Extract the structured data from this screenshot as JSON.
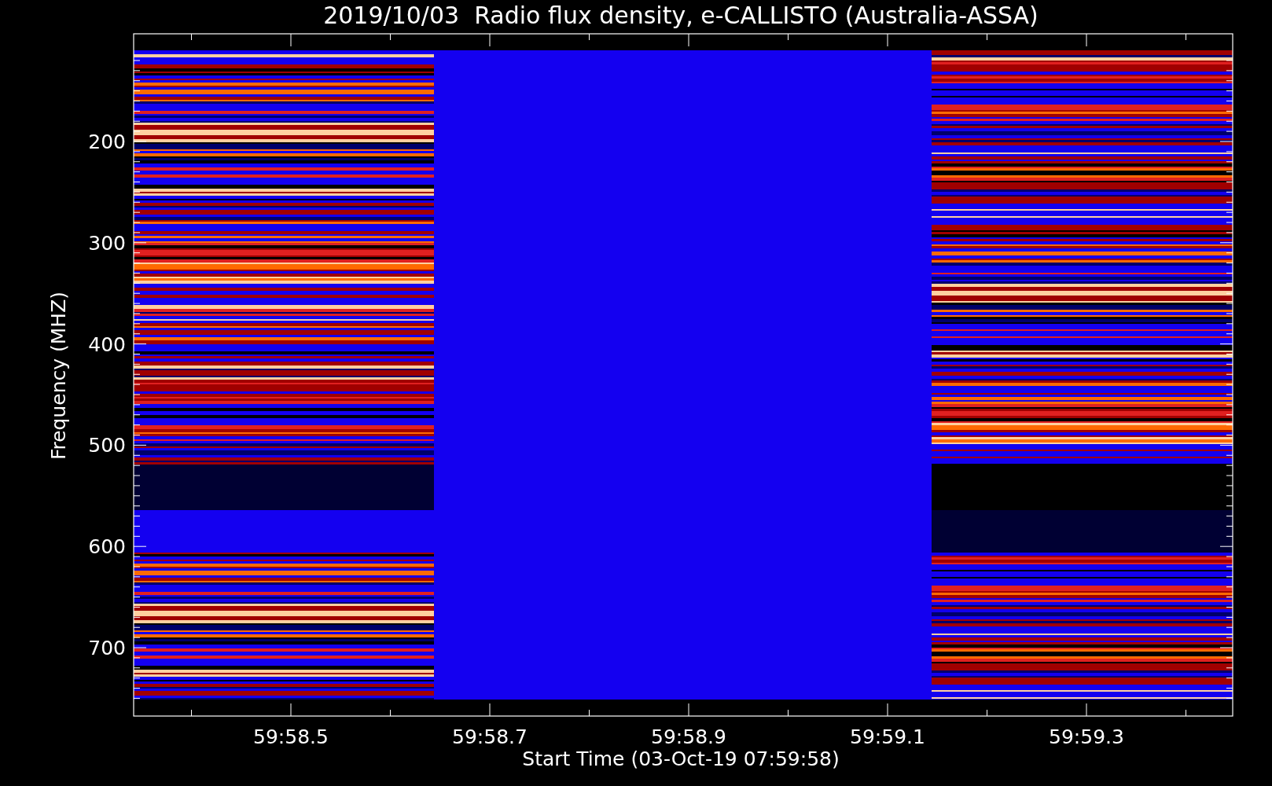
{
  "title": "2019/10/03  Radio flux density, e-CALLISTO (Australia-ASSA)",
  "y_axis": {
    "label": "Frequency (MHZ)",
    "ticks": [
      "200",
      "300",
      "400",
      "500",
      "600",
      "700"
    ]
  },
  "x_axis": {
    "label": "Start Time (03-Oct-19 07:59:58)",
    "ticks": [
      "59:58.5",
      "59:58.7",
      "59:58.9",
      "59:59.1",
      "59:59.3"
    ]
  }
}
